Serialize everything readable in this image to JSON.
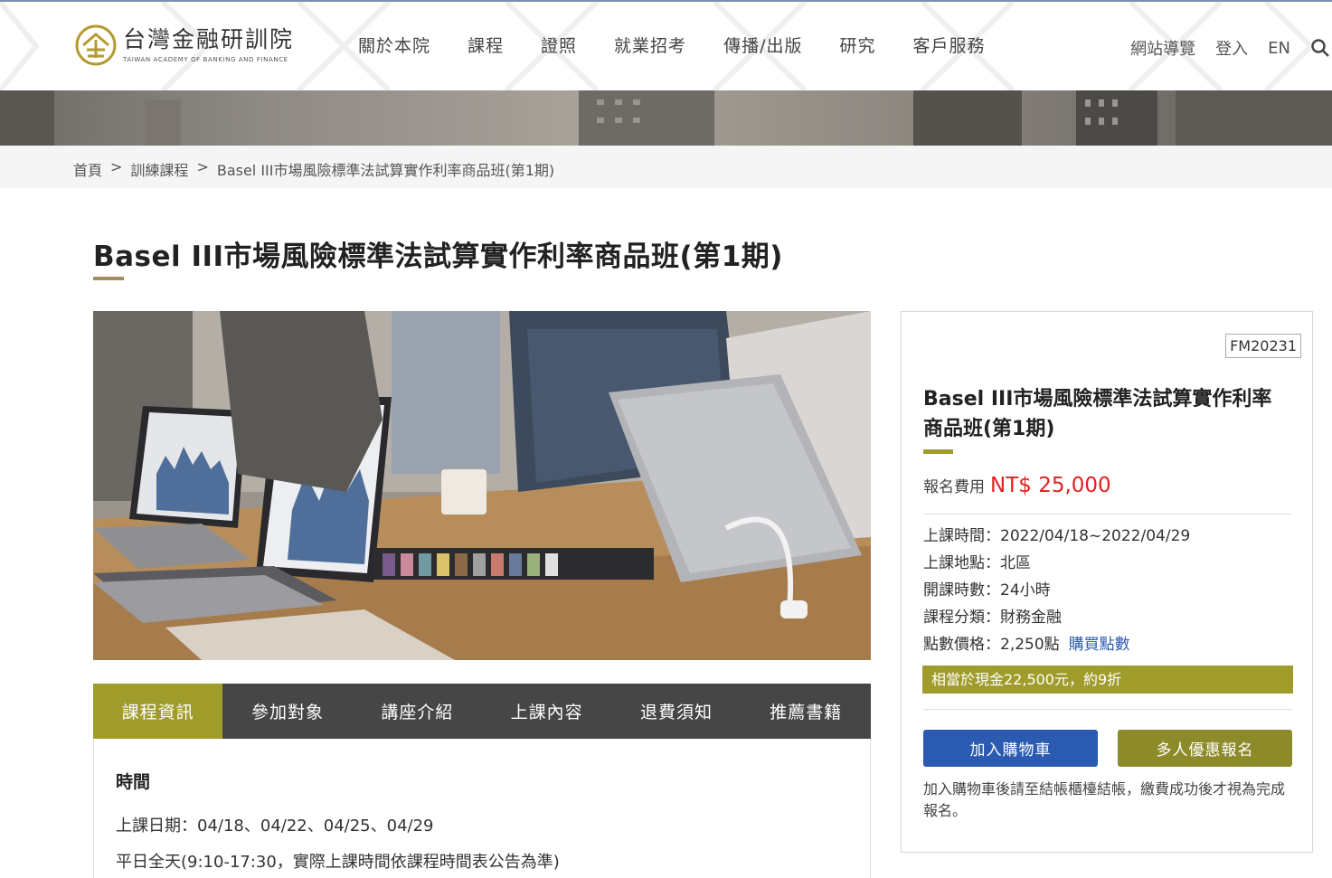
{
  "header": {
    "logo_zh": "台灣金融研訓院",
    "logo_en": "TAIWAN ACADEMY OF BANKING AND FINANCE",
    "nav": [
      "關於本院",
      "課程",
      "證照",
      "就業招考",
      "傳播/出版",
      "研究",
      "客戶服務"
    ],
    "util": {
      "sitemap": "網站導覽",
      "login": "登入",
      "lang": "EN"
    },
    "search_icon": "search-icon"
  },
  "breadcrumb": {
    "home": "首頁",
    "sep1": ">",
    "training": "訓練課程",
    "sep2": ">",
    "current": "Basel III市場風險標準法試算實作利率商品班(第1期)"
  },
  "page": {
    "title": "Basel III市場風險標準法試算實作利率商品班(第1期)"
  },
  "tabs": [
    {
      "label": "課程資訊",
      "active": true
    },
    {
      "label": "參加對象",
      "active": false
    },
    {
      "label": "講座介紹",
      "active": false
    },
    {
      "label": "上課內容",
      "active": false
    },
    {
      "label": "退費須知",
      "active": false
    },
    {
      "label": "推薦書籍",
      "active": false
    }
  ],
  "content": {
    "heading": "時間",
    "date_line": "上課日期：04/18、04/22、04/25、04/29",
    "time_line": "平日全天(9:10-17:30，實際上課時間依課程時間表公告為準)"
  },
  "card": {
    "code": "FM20231",
    "title": "Basel III市場風險標準法試算實作利率商品班(第1期)",
    "fee_label": "報名費用",
    "fee_value": "NT$ 25,000",
    "info": {
      "time": "上課時間：2022/04/18~2022/04/29",
      "location": "上課地點：北區",
      "hours": "開課時數：24小時",
      "category": "課程分類：財務金融",
      "points": "點數價格：2,250點",
      "buy_points": "購買點數"
    },
    "discount": "相當於現金22,500元，約9折",
    "add_cart": "加入購物車",
    "group_signup": "多人優惠報名",
    "note": "加入購物車後請至結帳櫃檯結帳，繳費成功後才視為完成報名。"
  },
  "colors": {
    "accent_olive": "#a09c2c",
    "blue_button": "#2b5bb1",
    "price_red": "#e61e1e",
    "title_underline": "#a68c5e"
  }
}
